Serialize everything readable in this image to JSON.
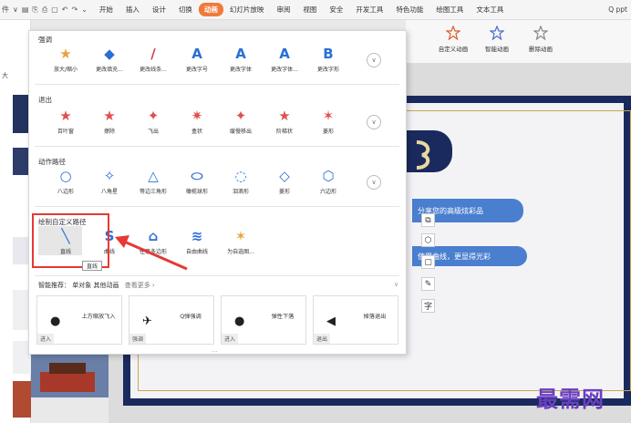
{
  "menubar": {
    "file_stub": "件",
    "tabs": [
      "开始",
      "插入",
      "设计",
      "切换",
      "动画",
      "幻灯片放映",
      "审阅",
      "视图",
      "安全",
      "开发工具",
      "特色功能",
      "绘图工具",
      "文本工具"
    ],
    "active_tab_index": 4,
    "search": "Q ppt"
  },
  "ribbon_right": [
    "自定义动画",
    "智能动画",
    "删除动画"
  ],
  "left_label": "大",
  "panel": {
    "emphasis": {
      "title": "强调",
      "items": [
        "放大/缩小",
        "更改填充...",
        "更改线条...",
        "更改字号",
        "更改字体",
        "更改字体...",
        "更改字形"
      ]
    },
    "exit": {
      "title": "退出",
      "items": [
        "百叶窗",
        "擦除",
        "飞出",
        "盒状",
        "缓慢移出",
        "阶梯状",
        "菱形"
      ]
    },
    "motion": {
      "title": "动作路径",
      "items": [
        "八边形",
        "八角星",
        "等边三角形",
        "橄榄球形",
        "泪滴形",
        "菱形",
        "六边形"
      ]
    },
    "custom": {
      "title": "绘制自定义路径",
      "items": [
        "直线",
        "曲线",
        "任意多边形",
        "自由曲线",
        "为自选图..."
      ],
      "tooltip": "直线"
    },
    "smart": {
      "title": "智能推荐：",
      "sub": "单对象 其他动画",
      "more": "查看更多 ›",
      "cards": [
        {
          "name": "上方缩放飞入",
          "tag": "进入"
        },
        {
          "name": "Q弹强调",
          "tag": "强调"
        },
        {
          "name": "弹性下落",
          "tag": "进入"
        },
        {
          "name": "掉落退出",
          "tag": "退出"
        }
      ]
    }
  },
  "slide": {
    "banner1": "分享您的高级炫彩品",
    "banner2": "使用曲线，更显得光彩"
  },
  "fab_labels": {
    "text": "字"
  },
  "watermark": "最需网",
  "colors": {
    "accent": "#f07a3a",
    "slide_border": "#1b2a5e",
    "banner": "#4a7fcf",
    "selection": "#e53935"
  }
}
